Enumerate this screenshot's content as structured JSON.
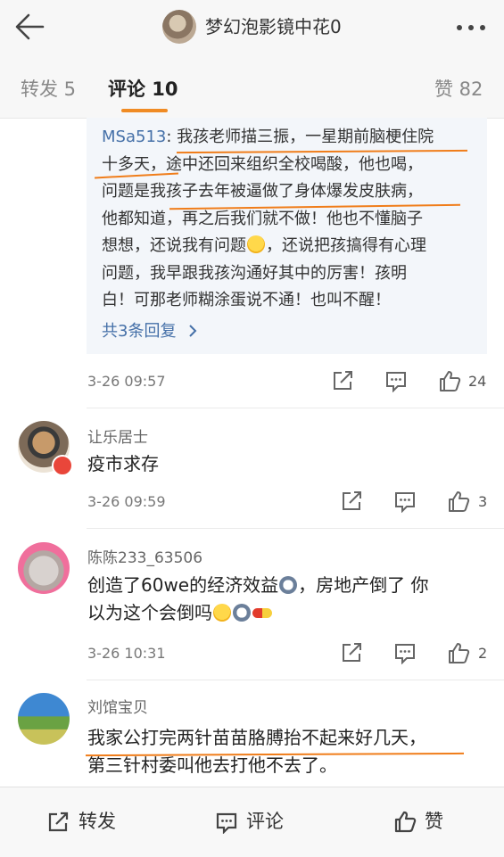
{
  "header": {
    "title": "梦幻泡影镜中花0"
  },
  "tabs": {
    "repost": "转发 5",
    "comment": "评论 10",
    "like": "赞 82"
  },
  "reply_block": {
    "user": "MSa513",
    "colon": ": ",
    "lines": [
      "我孩老师描三振，一星期前脑梗住院",
      "十多天，途中还回来组织全校喝酸，他也喝，",
      "问题是我孩子去年被逼做了身体爆发皮肤病，",
      "他都知道，再之后我们就不做！他也不懂脑子",
      "想想，还说我有问题",
      "，还说把孩搞得有心理",
      "问题，我早跟我孩沟通好其中的厉害！孩明",
      "白！可那老师糊涂蛋说不通！也叫不醒！"
    ],
    "more_replies": "共3条回复",
    "time": "3-26 09:57",
    "likes": "24"
  },
  "comments": [
    {
      "user": "让乐居士",
      "text": "疫市求存",
      "time": "3-26 09:59",
      "likes": "3"
    },
    {
      "user": "陈陈233_63506",
      "text_line1a": "创造了60we的经济效益",
      "text_line1b": "，房地产倒了 你",
      "text_line2": "以为这个会倒吗",
      "time": "3-26 10:31",
      "likes": "2"
    },
    {
      "user": "刘馆宝贝",
      "text_line1": "我家公打完两针苗苗胳膊抬不起来好几天，",
      "text_line2": "第三针村委叫他去打他不去了。"
    }
  ],
  "bottom_bar": {
    "repost": "转发",
    "comment": "评论",
    "like": "赞"
  },
  "colors": {
    "accent": "#f08b23",
    "link": "#4570a8",
    "highlight_underline": "#f07d1a"
  }
}
